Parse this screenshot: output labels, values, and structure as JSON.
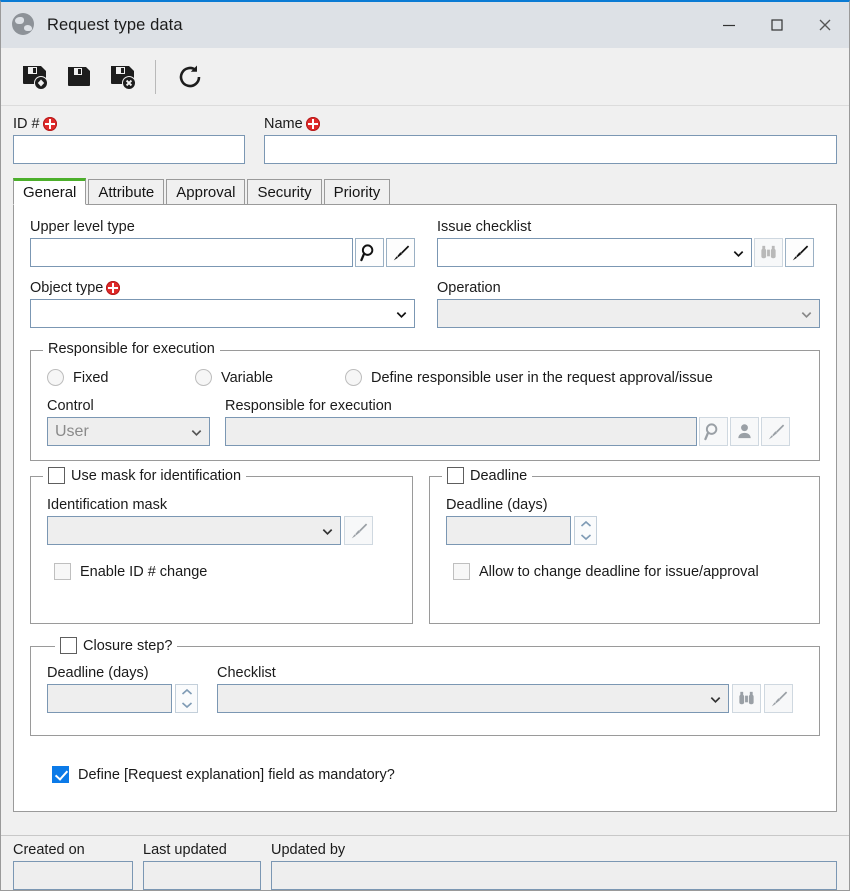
{
  "window": {
    "title": "Request type data",
    "icon": "globe-icon",
    "controls": {
      "minimize": "minimize-icon",
      "maximize": "maximize-icon",
      "close": "close-icon"
    },
    "accent_color": "#0a7bd4",
    "titlebar_color": "#dde1e6"
  },
  "toolbar": {
    "buttons": [
      {
        "name": "save-and-new-button",
        "icon": "save-new-icon"
      },
      {
        "name": "save-button",
        "icon": "save-icon"
      },
      {
        "name": "save-and-close-button",
        "icon": "save-close-icon"
      },
      {
        "name": "refresh-button",
        "icon": "refresh-icon"
      }
    ]
  },
  "header_fields": {
    "id": {
      "label": "ID #",
      "required": true,
      "value": ""
    },
    "name": {
      "label": "Name",
      "required": true,
      "value": ""
    }
  },
  "tabs": [
    {
      "label": "General",
      "active": true
    },
    {
      "label": "Attribute",
      "active": false
    },
    {
      "label": "Approval",
      "active": false
    },
    {
      "label": "Security",
      "active": false
    },
    {
      "label": "Priority",
      "active": false
    }
  ],
  "general": {
    "upper_level_type": {
      "label": "Upper level type",
      "value": "",
      "icons": [
        "search-icon",
        "brush-icon"
      ]
    },
    "issue_checklist": {
      "label": "Issue checklist",
      "value": "",
      "icons": [
        "binoculars-icon",
        "brush-icon"
      ]
    },
    "object_type": {
      "label": "Object type",
      "required": true,
      "value": ""
    },
    "operation": {
      "label": "Operation",
      "value": "",
      "disabled": true
    },
    "responsible_group": {
      "legend": "Responsible for execution",
      "radios": [
        {
          "label": "Fixed",
          "selected": false
        },
        {
          "label": "Variable",
          "selected": false
        },
        {
          "label": "Define responsible user in the request approval/issue",
          "selected": false
        }
      ],
      "control": {
        "label": "Control",
        "value": "User",
        "disabled": true
      },
      "responsible": {
        "label": "Responsible for execution",
        "value": "",
        "disabled": true,
        "icons": [
          "search-icon",
          "user-icon",
          "brush-icon"
        ]
      }
    },
    "mask_group": {
      "legend": "Use mask for identification",
      "checked": false,
      "identification_mask": {
        "label": "Identification mask",
        "value": "",
        "disabled": true,
        "icons": [
          "brush-icon"
        ]
      },
      "enable_id_change": {
        "label": "Enable ID # change",
        "checked": false,
        "disabled": true
      }
    },
    "deadline_group": {
      "legend": "Deadline",
      "checked": false,
      "deadline_days": {
        "label": "Deadline (days)",
        "value": "",
        "disabled": true
      },
      "allow_change": {
        "label": "Allow to change deadline for issue/approval",
        "checked": false,
        "disabled": true
      }
    },
    "closure_group": {
      "legend": "Closure step?",
      "checked": false,
      "deadline_days": {
        "label": "Deadline (days)",
        "value": "",
        "disabled": true
      },
      "checklist": {
        "label": "Checklist",
        "value": "",
        "disabled": true,
        "icons": [
          "binoculars-icon",
          "brush-icon"
        ]
      }
    },
    "mandatory_explanation": {
      "label": "Define [Request explanation] field as mandatory?",
      "checked": true
    }
  },
  "footer": {
    "created_on": {
      "label": "Created on",
      "value": "",
      "disabled": true
    },
    "last_updated": {
      "label": "Last updated",
      "value": "",
      "disabled": true
    },
    "updated_by": {
      "label": "Updated by",
      "value": "",
      "disabled": true
    }
  }
}
